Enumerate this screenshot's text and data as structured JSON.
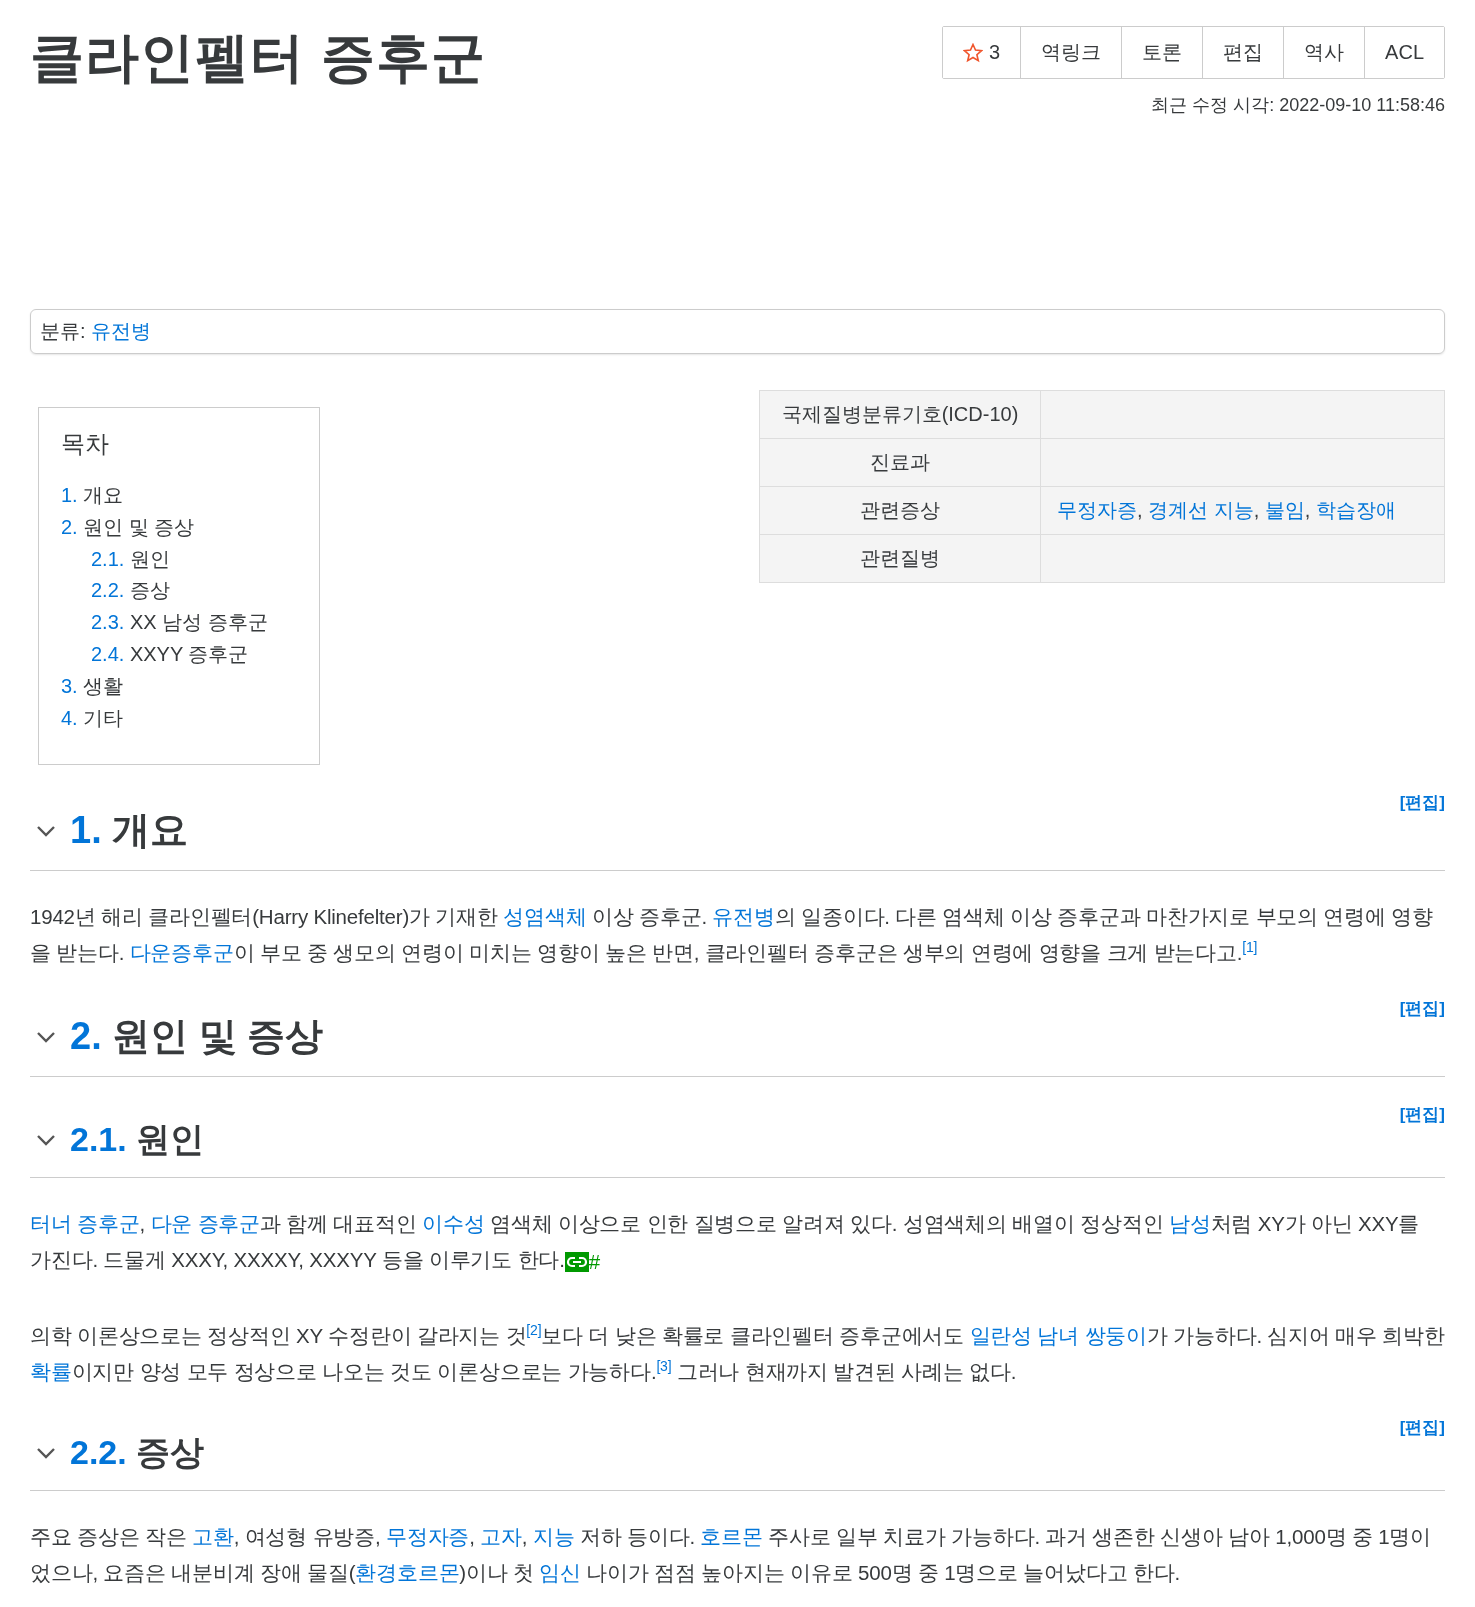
{
  "title": "클라인펠터 증후군",
  "actions": [
    {
      "kind": "star",
      "label": "3"
    },
    {
      "kind": "plain",
      "label": "역링크"
    },
    {
      "kind": "plain",
      "label": "토론"
    },
    {
      "kind": "plain",
      "label": "편집"
    },
    {
      "kind": "plain",
      "label": "역사"
    },
    {
      "kind": "plain",
      "label": "ACL"
    }
  ],
  "last_modified": "최근 수정 시각: 2022-09-10 11:58:46",
  "category": {
    "label": "분류:",
    "links": [
      "유전병"
    ]
  },
  "toc": {
    "title": "목차",
    "items": [
      {
        "number": "1.",
        "title": "개요"
      },
      {
        "number": "2.",
        "title": "원인 및 증상",
        "children": [
          {
            "number": "2.1.",
            "title": "원인"
          },
          {
            "number": "2.2.",
            "title": "증상"
          },
          {
            "number": "2.3.",
            "title": "XX 남성 증후군"
          },
          {
            "number": "2.4.",
            "title": "XXYY 증후군"
          }
        ]
      },
      {
        "number": "3.",
        "title": "생활"
      },
      {
        "number": "4.",
        "title": "기타"
      }
    ]
  },
  "infobox": [
    {
      "label": "국제질병분류기호(ICD-10)"
    },
    {
      "label": "진료과"
    },
    {
      "label": "관련증상",
      "value": [
        {
          "kind": "link",
          "text": "무정자증"
        },
        {
          "kind": "text",
          "text": ", "
        },
        {
          "kind": "link",
          "text": "경계선 지능"
        },
        {
          "kind": "text",
          "text": ", "
        },
        {
          "kind": "link",
          "text": "불임"
        },
        {
          "kind": "text",
          "text": ", "
        },
        {
          "kind": "link",
          "text": "학습장애"
        }
      ]
    },
    {
      "label": "관련질병"
    }
  ],
  "sections": [
    {
      "number": "1.",
      "title": "개요",
      "edit": "[편집]",
      "expanded": true,
      "paragraphs": [
        [
          {
            "kind": "text",
            "text": "1942년 해리 클라인펠터(Harry Klinefelter)가 기재한 "
          },
          {
            "kind": "link",
            "text": "성염색체"
          },
          {
            "kind": "text",
            "text": " 이상 증후군. "
          },
          {
            "kind": "link",
            "text": "유전병"
          },
          {
            "kind": "text",
            "text": "의 일종이다. 다른 염색체 이상 증후군과 마찬가지로 부모의 연령에 영향을 받는다. "
          },
          {
            "kind": "link",
            "text": "다운증후군"
          },
          {
            "kind": "text",
            "text": "이 부모 중 생모의 연령이 미치는 영향이 높은 반면, 클라인펠터 증후군은 생부의 연령에 영향을 크게 받는다고."
          },
          {
            "kind": "ref",
            "text": "[1]"
          }
        ]
      ]
    },
    {
      "number": "2.",
      "title": "원인 및 증상",
      "edit": "[편집]",
      "expanded": true,
      "children": [
        {
          "number": "2.1.",
          "title": "원인",
          "edit": "[편집]",
          "expanded": true,
          "paragraphs": [
            [
              {
                "kind": "link",
                "text": "터너 증후군"
              },
              {
                "kind": "text",
                "text": ", "
              },
              {
                "kind": "link",
                "text": "다운 증후군"
              },
              {
                "kind": "text",
                "text": "과 함께 대표적인 "
              },
              {
                "kind": "link",
                "text": "이수성"
              },
              {
                "kind": "text",
                "text": " 염색체 이상으로 인한 질병으로 알려져 있다. 성염색체의 배열이 정상적인 "
              },
              {
                "kind": "link",
                "text": "남성"
              },
              {
                "kind": "text",
                "text": "처럼 XY가 아닌 XXY를 가진다. 드물게 XXXY, XXXXY, XXXYY 등을 이루기도 한다."
              },
              {
                "kind": "anchor",
                "text": "#"
              }
            ],
            [
              {
                "kind": "text",
                "text": "의학 이론상으로는 정상적인 XY 수정란이 갈라지는 것"
              },
              {
                "kind": "ref",
                "text": "[2]"
              },
              {
                "kind": "text",
                "text": "보다 더 낮은 확률로 클라인펠터 증후군에서도 "
              },
              {
                "kind": "link",
                "text": "일란성 남녀 쌍둥이"
              },
              {
                "kind": "text",
                "text": "가 가능하다. 심지어 매우 희박한 "
              },
              {
                "kind": "link",
                "text": "확률"
              },
              {
                "kind": "text",
                "text": "이지만 양성 모두 정상으로 나오는 것도 이론상으로는 가능하다."
              },
              {
                "kind": "ref",
                "text": "[3]"
              },
              {
                "kind": "text",
                "text": " 그러나 현재까지 발견된 사례는 없다."
              }
            ]
          ]
        },
        {
          "number": "2.2.",
          "title": "증상",
          "edit": "[편집]",
          "expanded": true,
          "paragraphs": [
            [
              {
                "kind": "text",
                "text": "주요 증상은 작은 "
              },
              {
                "kind": "link",
                "text": "고환"
              },
              {
                "kind": "text",
                "text": ", 여성형 유방증, "
              },
              {
                "kind": "link",
                "text": "무정자증"
              },
              {
                "kind": "text",
                "text": ", "
              },
              {
                "kind": "link",
                "text": "고자"
              },
              {
                "kind": "text",
                "text": ", "
              },
              {
                "kind": "link",
                "text": "지능"
              },
              {
                "kind": "text",
                "text": " 저하 등이다. "
              },
              {
                "kind": "link",
                "text": "호르몬"
              },
              {
                "kind": "text",
                "text": " 주사로 일부 치료가 가능하다. 과거 생존한 신생아 남아 1,000명 중 1명이었으나, 요즘은 내분비계 장애 물질("
              },
              {
                "kind": "link",
                "text": "환경호르몬"
              },
              {
                "kind": "text",
                "text": ")이나 첫 "
              },
              {
                "kind": "link",
                "text": "임신"
              },
              {
                "kind": "text",
                "text": " 나이가 점점 높아지는 이유로 500명 중 1명으로 늘어났다고 한다."
              }
            ]
          ]
        }
      ]
    }
  ]
}
